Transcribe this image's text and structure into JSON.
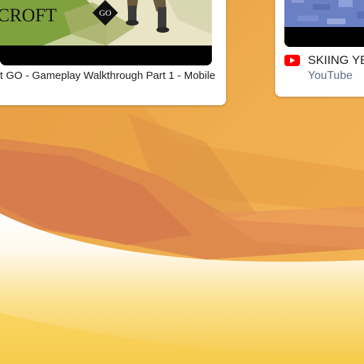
{
  "cards": [
    {
      "thumbnail_logo_text": "CROFT",
      "thumbnail_badge_text": "GO",
      "title": "t GO - Gameplay Walkthrough Part 1 - Mobile"
    },
    {
      "icon": "youtube-icon",
      "title": "SKIING YE",
      "source": "YouTube"
    }
  ],
  "colors": {
    "youtube_red": "#ff0000",
    "wallpaper_orange": "#efa84a",
    "source_text": "#5f6d86"
  }
}
